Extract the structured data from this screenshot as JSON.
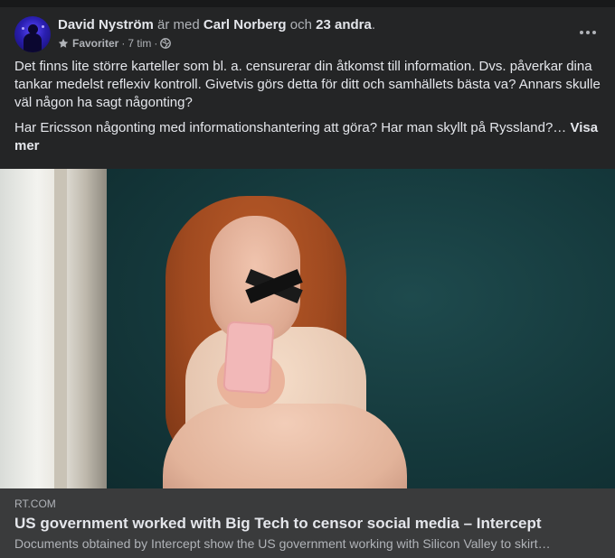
{
  "post": {
    "author": "David Nyström",
    "with_text": "är med",
    "tagged": "Carl Norberg",
    "and_text": "och",
    "others": "23 andra",
    "period": ".",
    "audience_label": "Favoriter",
    "time": "7 tim",
    "separator": "·",
    "icons": {
      "star": "star-icon",
      "globe": "globe-icon",
      "more": "more-options-icon"
    },
    "paragraphs": [
      "Det finns lite större karteller som bl. a. censurerar din åtkomst till information. Dvs. påverkar dina tankar medelst reflexiv kontroll. Givetvis görs detta för ditt och samhällets bästa va? Annars skulle väl någon ha sagt någonting?",
      "Har Ericsson någonting med informationshantering att göra? Har man skyllt på Ryssland?…"
    ],
    "see_more": "Visa mer"
  },
  "link_preview": {
    "domain": "RT.COM",
    "title": "US government worked with Big Tech to censor social media – Intercept",
    "description": "Documents obtained by Intercept show the US government working with Silicon Valley to skirt…"
  },
  "colors": {
    "card_bg": "#242526",
    "link_bg": "#3a3b3c",
    "primary_text": "#e4e6eb",
    "secondary_text": "#b0b3b8"
  }
}
